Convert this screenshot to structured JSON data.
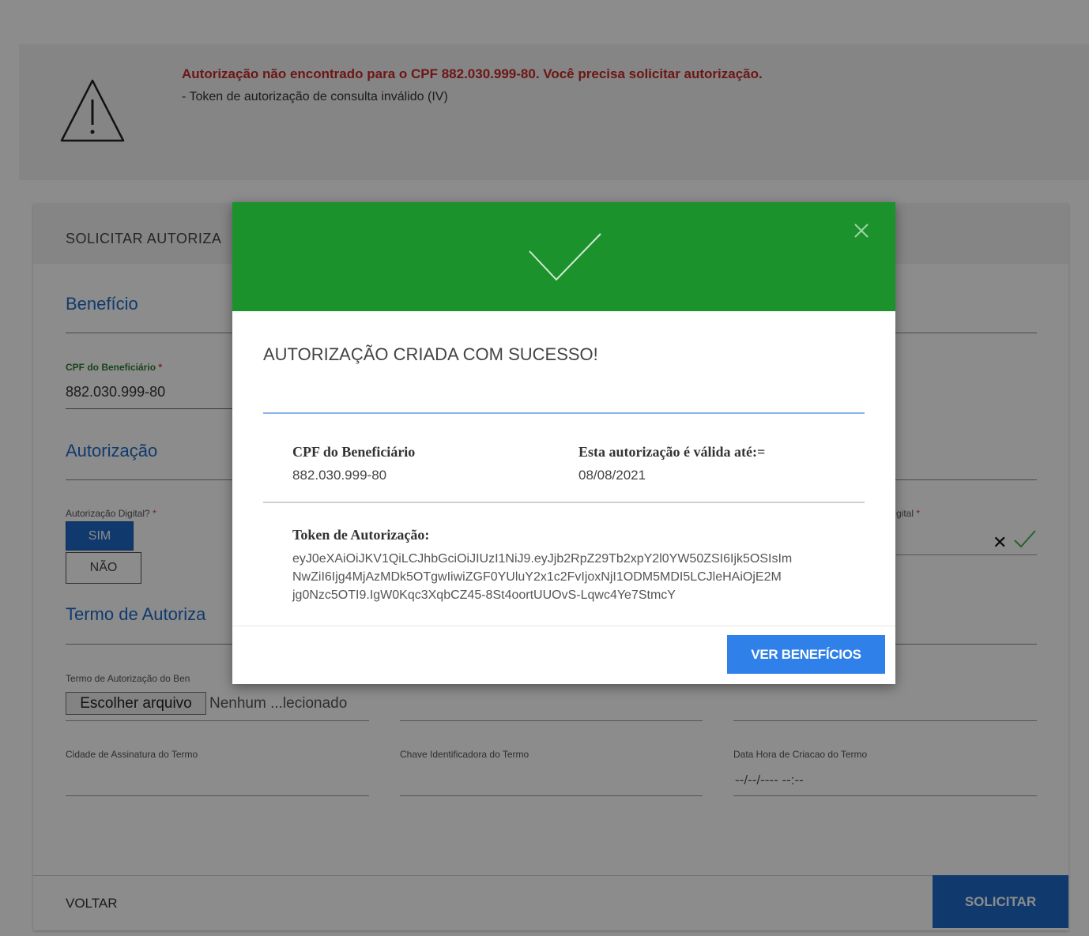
{
  "alert": {
    "icon": "warning-triangle-icon",
    "title": "Autorização não encontrado para o CPF 882.030.999-80. Você precisa solicitar autorização.",
    "detail": "- Token de autorização de consulta inválido (IV)"
  },
  "card": {
    "header_title": "SOLICITAR AUTORIZA"
  },
  "beneficio": {
    "section_title": "Benefício",
    "cpf_label": "CPF do Beneficiário",
    "required_mark": "*",
    "cpf_value": "882.030.999-80"
  },
  "autorizacao": {
    "section_title": "Autorização",
    "digital_label": "Autorização Digital?",
    "sim_label": "SIM",
    "nao_label": "NÃO",
    "right_label": "gital",
    "clear_icon": "close-icon",
    "valid_icon": "check-icon"
  },
  "termo": {
    "section_title": "Termo de Autoriza",
    "file_label": "Termo de Autorização do Ben",
    "file_button": "Escolher arquivo",
    "file_name": "Nenhum ...lecionado",
    "cidade_label": "Cidade de Assinatura do Termo",
    "chave_label": "Chave Identificadora do Termo",
    "data_label": "Data Hora de Criacao do Termo",
    "data_placeholder": "--/--/---- --:--"
  },
  "footer": {
    "voltar_label": "VOLTAR",
    "solicitar_label": "SOLICITAR"
  },
  "modal": {
    "header_color": "#1b922c",
    "check_icon": "check-icon",
    "close_icon": "close-icon",
    "title": "AUTORIZAÇÃO CRIADA COM SUCESSO!",
    "cpf_label": "CPF do Beneficiário",
    "cpf_value": "882.030.999-80",
    "valid_label": "Esta autorização é válida até:=",
    "valid_value": "08/08/2021",
    "token_label": "Token de Autorização:",
    "token_line1": "eyJ0eXAiOiJKV1QiLCJhbGciOiJIUzI1NiJ9.eyJjb2RpZ29Tb2xpY2l0YW50ZSI6Ijk5OSIsIm",
    "token_line2": "NwZiI6Ijg4MjAzMDk5OTgwIiwiZGF0YUluY2x1c2FvIjoxNjI1ODM5MDI5LCJleHAiOjE2M",
    "token_line3": "jg0Nzc5OTI9.IgW0Kqc3XqbCZ45-8St4oortUUOvS-Lqwc4Ye7StmcY",
    "button_label": "VER BENEFÍCIOS"
  }
}
